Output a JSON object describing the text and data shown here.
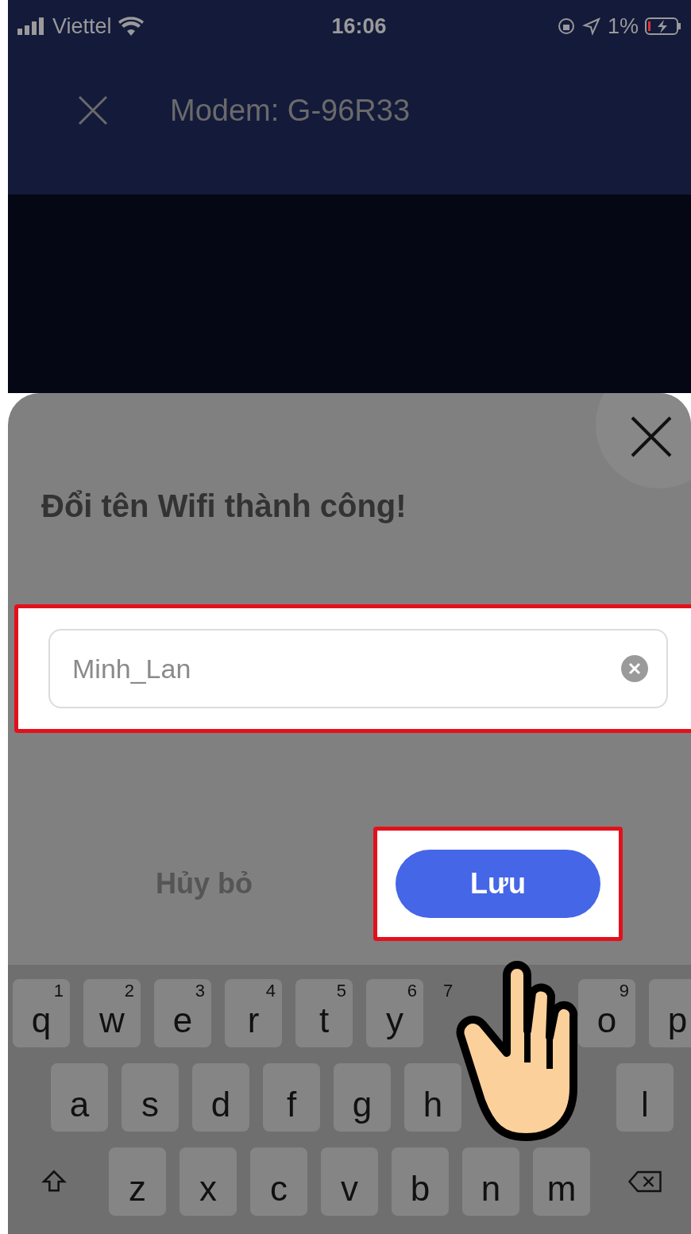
{
  "status_bar": {
    "carrier": "Viettel",
    "time": "16:06",
    "battery": "1%"
  },
  "header": {
    "title": "Modem: G-96R33"
  },
  "dialog": {
    "title": "Đổi tên Wifi thành công!",
    "field": {
      "value": "Minh_Lan"
    },
    "buttons": [
      {
        "label": "Hủy bỏ",
        "kind": "text"
      },
      {
        "label": "Lưu",
        "kind": "primary"
      }
    ]
  },
  "keyboard": {
    "rows": [
      [
        {
          "kind": "letter",
          "label": "q",
          "hint": "1"
        },
        {
          "kind": "letter",
          "label": "w",
          "hint": "2"
        },
        {
          "kind": "letter",
          "label": "e",
          "hint": "3"
        },
        {
          "kind": "letter",
          "label": "r",
          "hint": "4"
        },
        {
          "kind": "letter",
          "label": "t",
          "hint": "5"
        },
        {
          "kind": "letter",
          "label": "y",
          "hint": "6"
        },
        {
          "kind": "covered",
          "hint": "7"
        },
        {
          "kind": "covered"
        },
        {
          "kind": "letter",
          "label": "o",
          "hint": "9"
        },
        {
          "kind": "letter",
          "label": "p"
        }
      ],
      [
        {
          "kind": "letter",
          "label": "a"
        },
        {
          "kind": "letter",
          "label": "s"
        },
        {
          "kind": "letter",
          "label": "d"
        },
        {
          "kind": "letter",
          "label": "f"
        },
        {
          "kind": "letter",
          "label": "g"
        },
        {
          "kind": "letter",
          "label": "h"
        },
        {
          "kind": "covered"
        },
        {
          "kind": "covered"
        },
        {
          "kind": "letter",
          "label": "l"
        }
      ],
      [
        {
          "kind": "shift"
        },
        {
          "kind": "letter",
          "label": "z"
        },
        {
          "kind": "letter",
          "label": "x"
        },
        {
          "kind": "letter",
          "label": "c"
        },
        {
          "kind": "letter",
          "label": "v"
        },
        {
          "kind": "letter",
          "label": "b"
        },
        {
          "kind": "letter",
          "label": "n"
        },
        {
          "kind": "letter",
          "label": "m"
        },
        {
          "kind": "delete"
        }
      ]
    ]
  }
}
